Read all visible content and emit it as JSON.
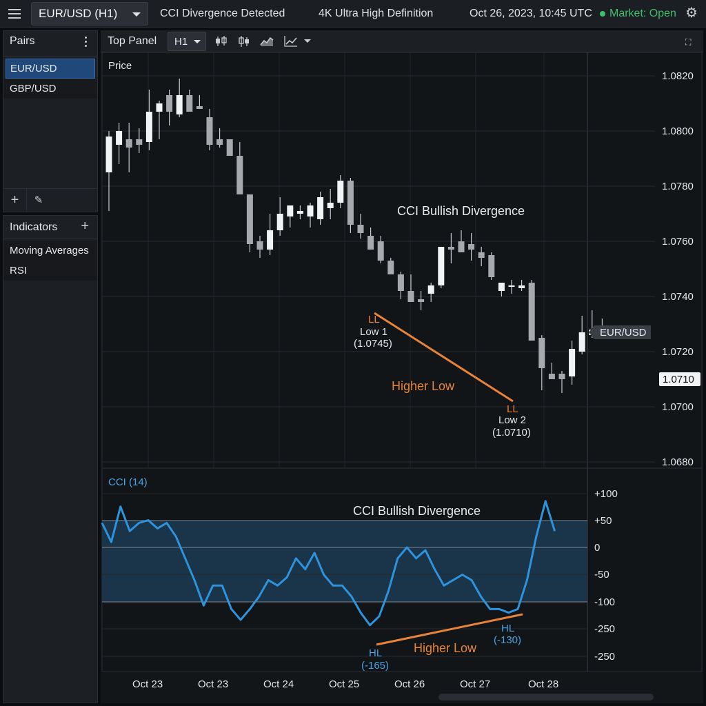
{
  "topbar": {
    "symbol": "EUR/USD (H1)",
    "alert": "CCI Divergence Detected",
    "resolution": "4K Ultra High Definition",
    "datetime": "Oct 26, 2023, 10:45 UTC",
    "market_status": "Market: Open",
    "status_color": "#3fbf6a"
  },
  "sidebar": {
    "pairs_title": "Pairs",
    "pairs": [
      {
        "label": "EUR/USD",
        "selected": true
      },
      {
        "label": "GBP/USD",
        "selected": false
      }
    ],
    "indicators_title": "Indicators",
    "indicators": [
      {
        "label": "Moving Averages"
      },
      {
        "label": "RSI"
      }
    ]
  },
  "chart_toolbar": {
    "panel_label": "Top Panel",
    "timeframe": "H1"
  },
  "chart_data": {
    "type": "candlestick",
    "price_panel": {
      "label": "Price",
      "y_ticks": [
        "1.0820",
        "1.0800",
        "1.0780",
        "1.0760",
        "1.0740",
        "1.0720",
        "1.0700",
        "1.0680"
      ],
      "ylim": [
        1.0678,
        1.0822
      ],
      "current_price": "1.0710",
      "symbol_tag": "EUR/USD",
      "candles": [
        [
          1.0785,
          1.08,
          1.0771,
          1.0798
        ],
        [
          1.0795,
          1.0803,
          1.0788,
          1.08
        ],
        [
          1.0797,
          1.0803,
          1.0785,
          1.0794
        ],
        [
          1.0797,
          1.0801,
          1.0792,
          1.0795
        ],
        [
          1.0796,
          1.0815,
          1.0793,
          1.0807
        ],
        [
          1.0807,
          1.0811,
          1.0797,
          1.081
        ],
        [
          1.0813,
          1.0815,
          1.0802,
          1.0807
        ],
        [
          1.0806,
          1.0819,
          1.0805,
          1.0813
        ],
        [
          1.0813,
          1.0815,
          1.0807,
          1.0807
        ],
        [
          1.0809,
          1.0813,
          1.0808,
          1.0808
        ],
        [
          1.0805,
          1.0808,
          1.0793,
          1.0795
        ],
        [
          1.0797,
          1.0801,
          1.0794,
          1.0795
        ],
        [
          1.0797,
          1.0795,
          1.0791,
          1.0791
        ],
        [
          1.0791,
          1.0796,
          1.0785,
          1.0777
        ],
        [
          1.0777,
          1.0777,
          1.0756,
          1.0759
        ],
        [
          1.076,
          1.0762,
          1.0754,
          1.0757
        ],
        [
          1.0757,
          1.077,
          1.0755,
          1.0764
        ],
        [
          1.0764,
          1.0776,
          1.0762,
          1.077
        ],
        [
          1.0769,
          1.0771,
          1.0765,
          1.0773
        ],
        [
          1.077,
          1.0773,
          1.0768,
          1.0771
        ],
        [
          1.0769,
          1.0774,
          1.0765,
          1.0773
        ],
        [
          1.0768,
          1.0778,
          1.0766,
          1.0776
        ],
        [
          1.0772,
          1.0779,
          1.0768,
          1.0774
        ],
        [
          1.0774,
          1.0784,
          1.0772,
          1.0782
        ],
        [
          1.0782,
          1.0783,
          1.0763,
          1.0766
        ],
        [
          1.0766,
          1.077,
          1.0761,
          1.0763
        ],
        [
          1.0762,
          1.0765,
          1.0757,
          1.0757
        ],
        [
          1.076,
          1.0762,
          1.0752,
          1.0753
        ],
        [
          1.0753,
          1.0754,
          1.0748,
          1.0748
        ],
        [
          1.0748,
          1.0749,
          1.0739,
          1.0742
        ],
        [
          1.0742,
          1.0748,
          1.0738,
          1.0738
        ],
        [
          1.0739,
          1.0742,
          1.0735,
          1.0738
        ],
        [
          1.0741,
          1.0745,
          1.0738,
          1.0744
        ],
        [
          1.0744,
          1.0755,
          1.0743,
          1.0758
        ],
        [
          1.0758,
          1.0763,
          1.0752,
          1.0757
        ],
        [
          1.076,
          1.0764,
          1.0757,
          1.0756
        ],
        [
          1.0759,
          1.0763,
          1.0753,
          1.0757
        ],
        [
          1.0756,
          1.0758,
          1.0751,
          1.0754
        ],
        [
          1.0755,
          1.0756,
          1.0746,
          1.0747
        ],
        [
          1.0742,
          1.0745,
          1.074,
          1.0745
        ],
        [
          1.0744,
          1.0746,
          1.0741,
          1.0744
        ],
        [
          1.0743,
          1.0746,
          1.0742,
          1.0744
        ],
        [
          1.0745,
          1.0746,
          1.0724,
          1.0724
        ],
        [
          1.0725,
          1.0726,
          1.0706,
          1.0714
        ],
        [
          1.0712,
          1.0716,
          1.071,
          1.071
        ],
        [
          1.0712,
          1.0713,
          1.0705,
          1.071
        ],
        [
          1.0711,
          1.0724,
          1.0708,
          1.0721
        ],
        [
          1.072,
          1.0733,
          1.0719,
          1.0727
        ],
        [
          1.0726,
          1.0735,
          1.0725,
          1.0728
        ],
        [
          1.0728,
          1.0732,
          1.0725,
          1.0728
        ]
      ],
      "annotations": {
        "divergence_title": "CCI Bullish Divergence",
        "low1_tag": "LL",
        "low1_label": "Low 1",
        "low1_value": "(1.0745)",
        "low2_tag": "LL",
        "low2_label": "Low 2",
        "low2_value": "(1.0710)",
        "trend_label": "Higher Low"
      }
    },
    "cci_panel": {
      "label": "CCI (14)",
      "y_ticks": [
        "+100",
        "+50",
        "0",
        "-50",
        "-100",
        "-250",
        "-250"
      ],
      "series_values": [
        45,
        10,
        75,
        30,
        45,
        50,
        35,
        45,
        20,
        -20,
        -60,
        -110,
        -70,
        -70,
        -120,
        -150,
        -120,
        -90,
        -60,
        -70,
        -55,
        -20,
        -40,
        -10,
        -50,
        -70,
        -70,
        -90,
        -130,
        -165,
        -140,
        -80,
        -20,
        0,
        -20,
        -5,
        -40,
        -70,
        -60,
        -50,
        -60,
        -90,
        -120,
        -120,
        -130,
        -120,
        -60,
        20,
        85,
        30
      ],
      "annotations": {
        "divergence_title": "CCI Bullish Divergence",
        "hl1_tag": "HL",
        "hl1_value": "(-165)",
        "hl2_tag": "HL",
        "hl2_value": "(-130)",
        "trend_label": "Higher Low"
      }
    },
    "x_ticks": [
      "Oct 23",
      "Oct 23",
      "Oct 24",
      "Oct 25",
      "Oct 26",
      "Oct 27",
      "Oct 28"
    ],
    "colors": {
      "up": "#f2f3f4",
      "down": "#a6aaae",
      "cci_line": "#2e93dd",
      "band": "#1c3a52",
      "trend": "#e8833a",
      "accent_blue": "#4aa3e0"
    }
  }
}
